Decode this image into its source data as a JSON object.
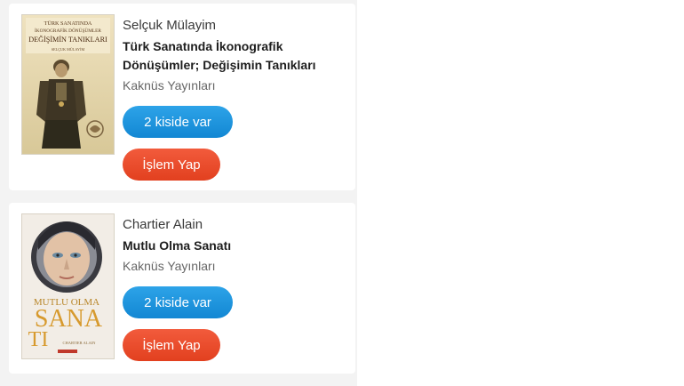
{
  "books": [
    {
      "author": "Selçuk  Mülayim",
      "title_line1": "Türk Sanatında İkonografik",
      "title_line2": "Dönüşümler; Değişimin Tanıkları",
      "publisher": "Kaknüs Yayınları",
      "availability_button": "2 kiside var",
      "action_button": "İşlem Yap",
      "cover": {
        "line1": "TÜRK SANATINDA",
        "line2": "İKONOGRAFİK DÖNÜŞÜMLER",
        "line3": "DEĞİŞİMİN TANIKLARI",
        "author": "SELÇUK MÜLAYİM"
      }
    },
    {
      "author": "Chartier  Alain",
      "title_line1": "Mutlu Olma Sanatı",
      "publisher": "Kaknüs Yayınları",
      "availability_button": "2 kiside var",
      "action_button": "İşlem Yap",
      "cover": {
        "line1": "MUTLU OLMA",
        "line2": "SANA",
        "line3": "TI",
        "author": "CHARTIER ALAIN"
      }
    }
  ],
  "colors": {
    "availability_button": "#1a8fd9",
    "action_button": "#e8472a"
  }
}
